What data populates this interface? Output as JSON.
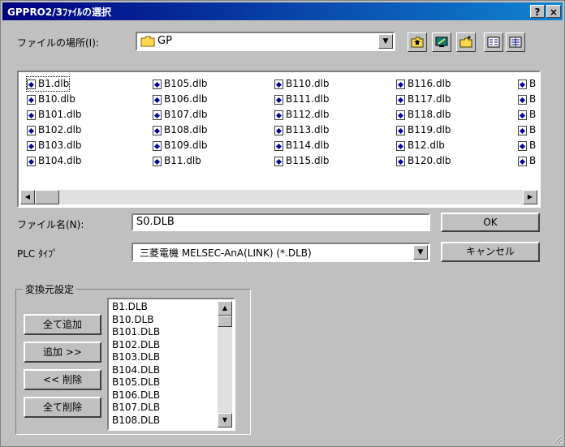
{
  "window": {
    "title": "GPPRO2/3ﾌｧｲﾙの選択",
    "help_label": "?",
    "close_label": "×"
  },
  "look_in": {
    "label": "ファイルの場所(I):",
    "value": "GP"
  },
  "files": [
    [
      "B1.dlb",
      "B10.dlb",
      "B101.dlb",
      "B102.dlb",
      "B103.dlb",
      "B104.dlb"
    ],
    [
      "B105.dlb",
      "B106.dlb",
      "B107.dlb",
      "B108.dlb",
      "B109.dlb",
      "B11.dlb"
    ],
    [
      "B110.dlb",
      "B111.dlb",
      "B112.dlb",
      "B113.dlb",
      "B114.dlb",
      "B115.dlb"
    ],
    [
      "B116.dlb",
      "B117.dlb",
      "B118.dlb",
      "B119.dlb",
      "B12.dlb",
      "B120.dlb"
    ],
    [
      "B",
      "B",
      "B",
      "B",
      "B",
      "B"
    ]
  ],
  "filename": {
    "label": "ファイル名(N):",
    "value": "S0.DLB"
  },
  "plc_type": {
    "label": "PLC ﾀｲﾌﾟ",
    "value": "三菱電機 MELSEC-AnA(LINK)   (*.DLB)"
  },
  "buttons": {
    "ok": "OK",
    "cancel": "キャンセル",
    "add_all": "全て追加",
    "add": "追加 >>",
    "remove": "<< 削除",
    "remove_all": "全て削除"
  },
  "conversion_group": {
    "title": "変換元設定",
    "items": [
      "B1.DLB",
      "B10.DLB",
      "B101.DLB",
      "B102.DLB",
      "B103.DLB",
      "B104.DLB",
      "B105.DLB",
      "B106.DLB",
      "B107.DLB",
      "B108.DLB"
    ]
  },
  "icons": [
    "folder-icon",
    "up-folder-icon",
    "desktop-icon",
    "new-folder-icon",
    "list-view-icon",
    "details-view-icon",
    "file-icon"
  ]
}
